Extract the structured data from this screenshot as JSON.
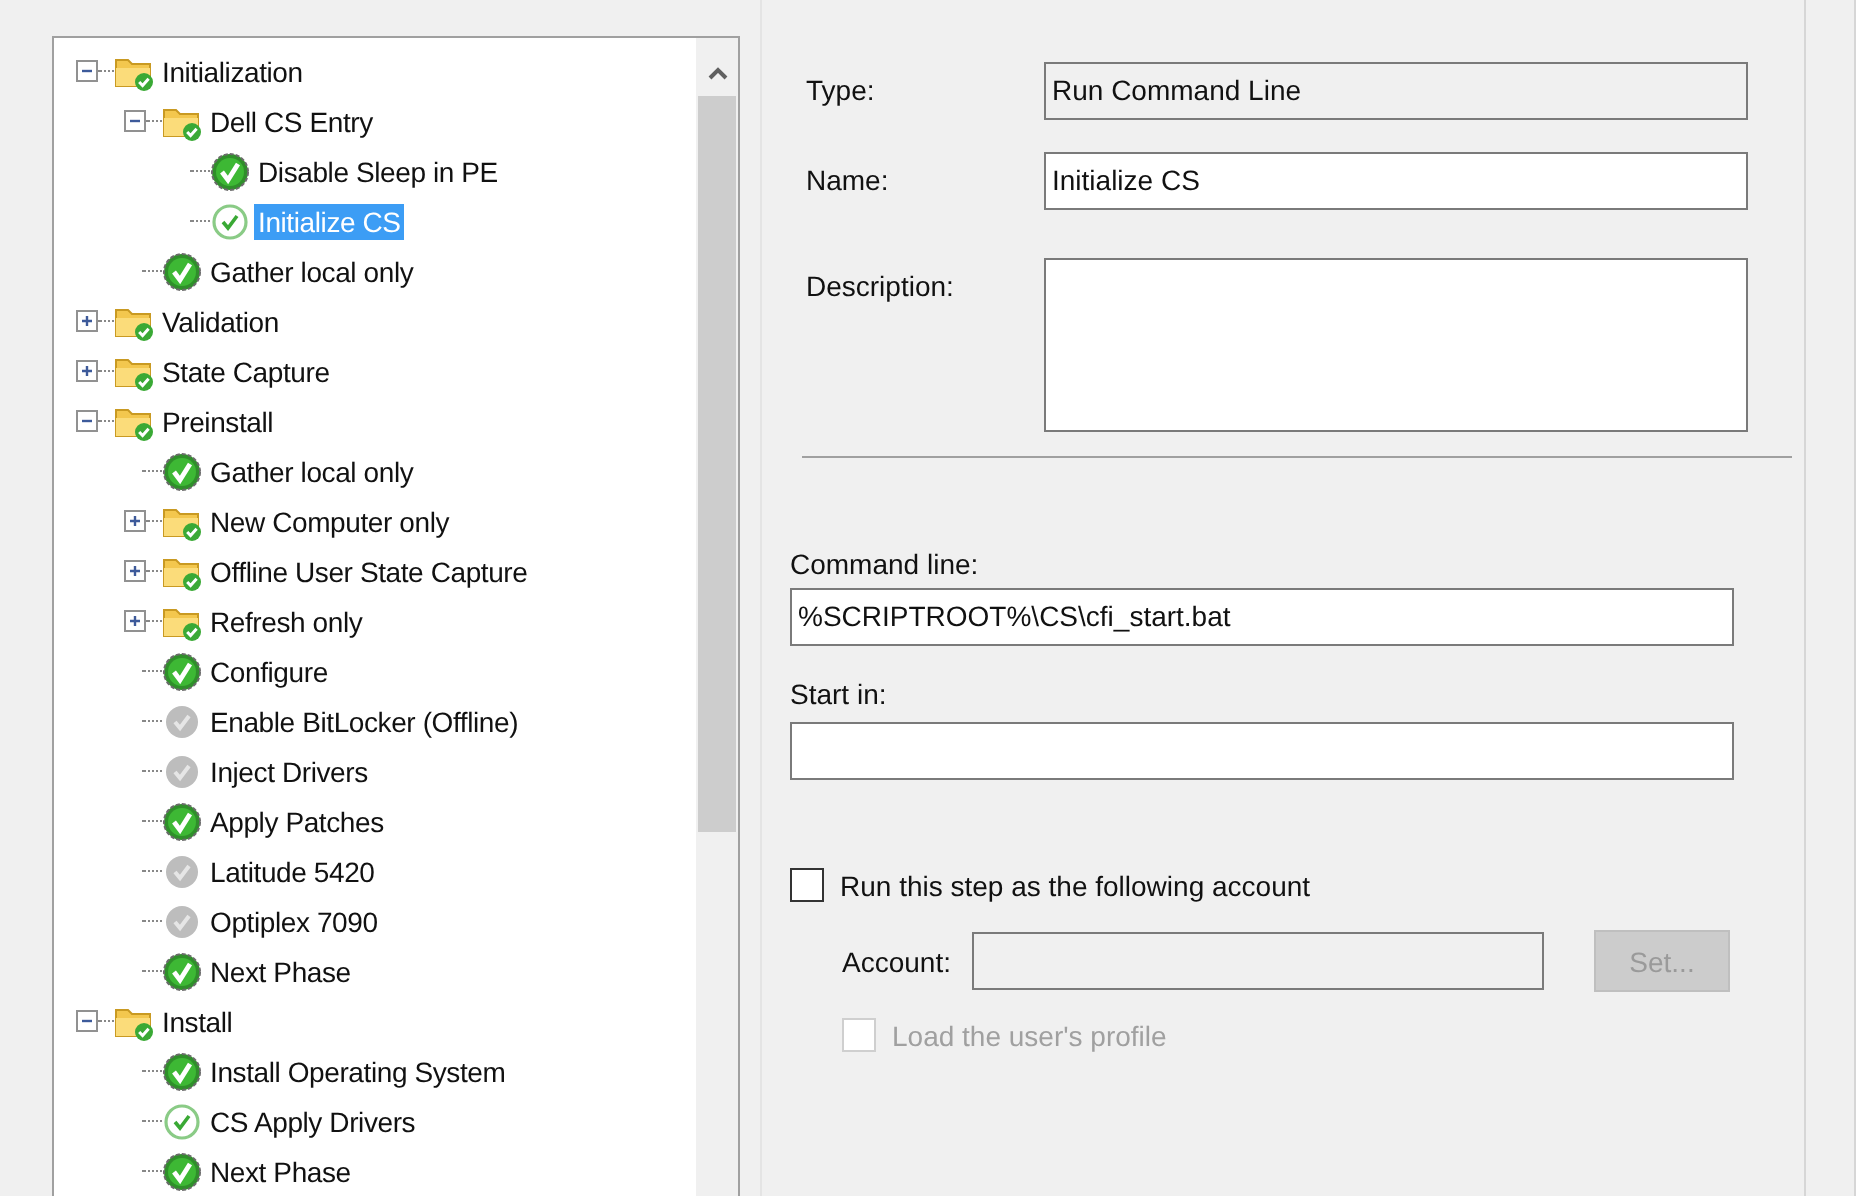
{
  "tree": {
    "items": [
      {
        "kind": "group",
        "label": "Initialization",
        "expanded": true,
        "selected": false,
        "children": [
          {
            "kind": "group",
            "label": "Dell CS Entry",
            "expanded": true,
            "selected": false,
            "children": [
              {
                "kind": "step",
                "label": "Disable Sleep in PE",
                "selected": false
              },
              {
                "kind": "step_outline",
                "label": "Initialize CS",
                "selected": true
              }
            ]
          },
          {
            "kind": "step",
            "label": "Gather local only",
            "selected": false
          }
        ]
      },
      {
        "kind": "group",
        "label": "Validation",
        "expanded": false,
        "selected": false
      },
      {
        "kind": "group",
        "label": "State Capture",
        "expanded": false,
        "selected": false
      },
      {
        "kind": "group",
        "label": "Preinstall",
        "expanded": true,
        "selected": false,
        "children": [
          {
            "kind": "step",
            "label": "Gather local only",
            "selected": false
          },
          {
            "kind": "group",
            "label": "New Computer only",
            "expanded": false,
            "selected": false
          },
          {
            "kind": "group",
            "label": "Offline User State Capture",
            "expanded": false,
            "selected": false
          },
          {
            "kind": "group",
            "label": "Refresh only",
            "expanded": false,
            "selected": false
          },
          {
            "kind": "step",
            "label": "Configure",
            "selected": false
          },
          {
            "kind": "step_disabled",
            "label": "Enable BitLocker (Offline)",
            "selected": false
          },
          {
            "kind": "step_disabled",
            "label": "Inject Drivers",
            "selected": false
          },
          {
            "kind": "step",
            "label": "Apply Patches",
            "selected": false
          },
          {
            "kind": "step_disabled",
            "label": "Latitude 5420",
            "selected": false
          },
          {
            "kind": "step_disabled",
            "label": "Optiplex 7090",
            "selected": false
          },
          {
            "kind": "step",
            "label": "Next Phase",
            "selected": false
          }
        ]
      },
      {
        "kind": "group",
        "label": "Install",
        "expanded": true,
        "selected": false,
        "children": [
          {
            "kind": "step",
            "label": "Install Operating System",
            "selected": false
          },
          {
            "kind": "step_outline",
            "label": "CS Apply Drivers",
            "selected": false
          },
          {
            "kind": "step",
            "label": "Next Phase",
            "selected": false
          }
        ]
      }
    ]
  },
  "form": {
    "type": {
      "label": "Type:",
      "value": "Run Command Line",
      "read_only": true
    },
    "name": {
      "label": "Name:",
      "value": "Initialize CS",
      "read_only": false
    },
    "description": {
      "label": "Description:"
    },
    "command_line": {
      "label": "Command line:",
      "value": "%SCRIPTROOT%\\CS\\cfi_start.bat"
    },
    "start_in": {
      "label": "Start in:"
    },
    "run_as": {
      "label": "Run this step as the following account",
      "checked": false,
      "disabled": false
    },
    "account": {
      "label": "Account:",
      "disabled": true
    },
    "set_button": {
      "label": "Set...",
      "disabled": true
    },
    "load_profile": {
      "label": "Load the user's profile",
      "checked": false,
      "disabled": true
    }
  }
}
